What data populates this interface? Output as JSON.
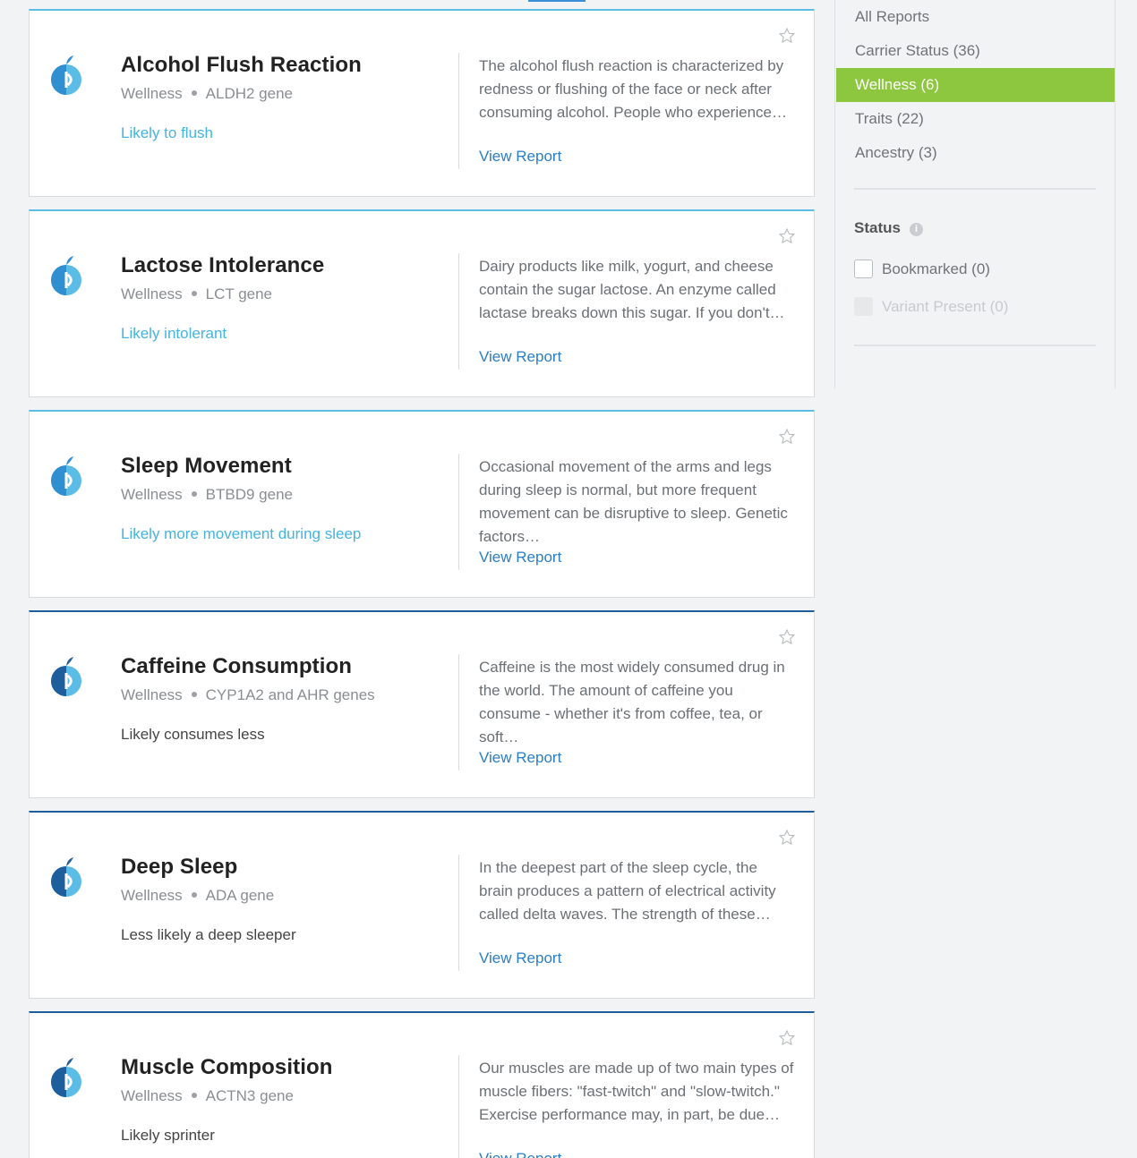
{
  "colors": {
    "light_accent": "#5bbde6",
    "dark_accent": "#1f5e9c",
    "active_nav": "#8dc63f",
    "link": "#2a7ec6"
  },
  "reports": [
    {
      "title": "Alcohol Flush Reaction",
      "category": "Wellness",
      "gene": "ALDH2 gene",
      "result": "Likely to flush",
      "description": "The alcohol flush reaction is characterized by redness or flushing of the face or neck after consuming alcohol. People who experience…",
      "link": "View Report",
      "icon": "wellness-icon"
    },
    {
      "title": "Lactose Intolerance",
      "category": "Wellness",
      "gene": "LCT gene",
      "result": "Likely intolerant",
      "description": "Dairy products like milk, yogurt, and cheese contain the sugar lactose. An enzyme called lactase breaks down this sugar. If you don't…",
      "link": "View Report",
      "icon": "wellness-icon"
    },
    {
      "title": "Sleep Movement",
      "category": "Wellness",
      "gene": "BTBD9 gene",
      "result": "Likely more movement during sleep",
      "description": "Occasional movement of the arms and legs during sleep is normal, but more frequent movement can be disruptive to sleep. Genetic factors…",
      "link": "View Report",
      "icon": "wellness-icon"
    },
    {
      "title": "Caffeine Consumption",
      "category": "Wellness",
      "gene": "CYP1A2 and AHR genes",
      "result": "Likely consumes less",
      "description": "Caffeine is the most widely consumed drug in the world. The amount of caffeine you consume - whether it's from coffee, tea, or soft…",
      "link": "View Report",
      "icon": "wellness-icon"
    },
    {
      "title": "Deep Sleep",
      "category": "Wellness",
      "gene": "ADA gene",
      "result": "Less likely a deep sleeper",
      "description": "In the deepest part of the sleep cycle, the brain produces a pattern of electrical activity called delta waves. The strength of these…",
      "link": "View Report",
      "icon": "wellness-icon"
    },
    {
      "title": "Muscle Composition",
      "category": "Wellness",
      "gene": "ACTN3 gene",
      "result": "Likely sprinter",
      "description": "Our muscles are made up of two main types of muscle fibers: \"fast-twitch\" and \"slow-twitch.\" Exercise performance may, in part, be due…",
      "link": "View Report",
      "icon": "wellness-icon"
    }
  ],
  "sidebar": {
    "nav": [
      {
        "label": "All Reports"
      },
      {
        "label": "Carrier Status (36)"
      },
      {
        "label": "Wellness (6)",
        "active": true
      },
      {
        "label": "Traits (22)"
      },
      {
        "label": "Ancestry (3)"
      }
    ],
    "status_heading": "Status",
    "filters": [
      {
        "label": "Bookmarked (0)",
        "enabled": true
      },
      {
        "label": "Variant Present (0)",
        "enabled": false
      }
    ]
  }
}
